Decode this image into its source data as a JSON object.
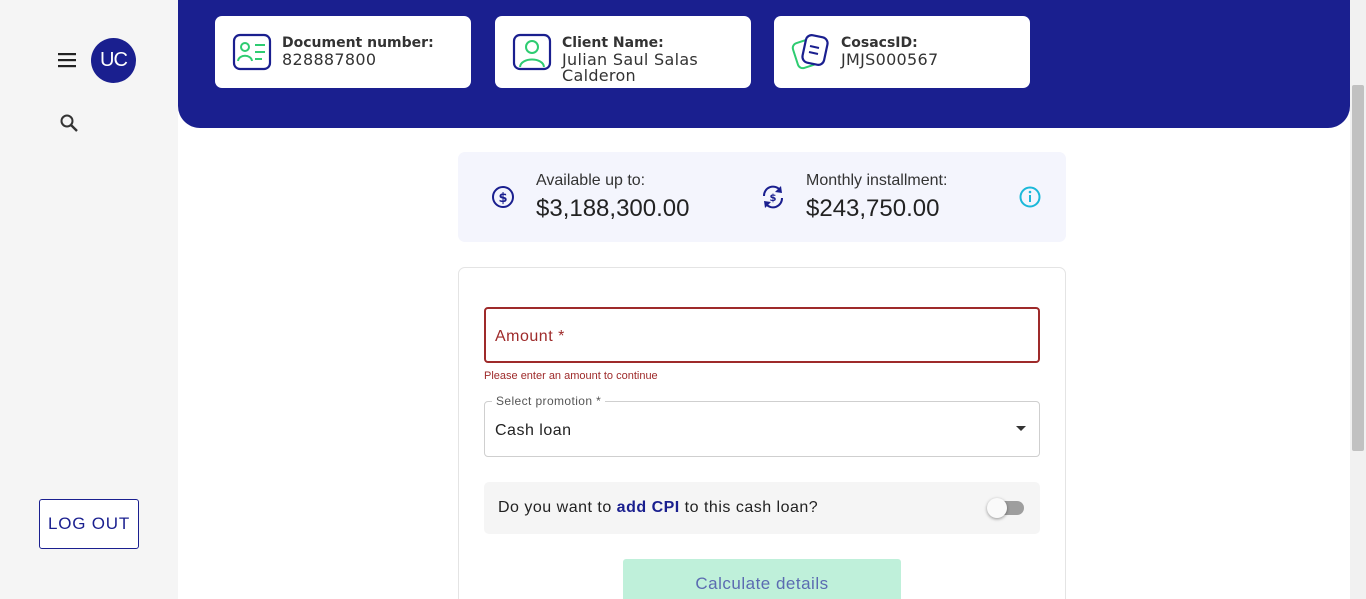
{
  "sidebar": {
    "menu_icon": "menu-icon",
    "avatar_initials": "UC",
    "search_icon": "search-icon",
    "logout_label": "LOG OUT"
  },
  "header": {
    "cards": [
      {
        "icon": "id-card-icon",
        "label": "Document number:",
        "value": "828887800"
      },
      {
        "icon": "user-icon",
        "label": "Client Name:",
        "value": "Julian Saul Salas Calderon"
      },
      {
        "icon": "document-icon",
        "label": "CosacsID:",
        "value": "JMJS000567"
      }
    ]
  },
  "summary": {
    "available_label": "Available up to:",
    "available_value": "$3,188,300.00",
    "installment_label": "Monthly installment:",
    "installment_value": "$243,750.00",
    "info_icon": "info-icon"
  },
  "form": {
    "amount_label": "Amount *",
    "amount_value": "",
    "amount_error": "Please enter an amount to continue",
    "promotion_label": "Select promotion *",
    "promotion_value": "Cash loan",
    "cpi_question_before": "Do you want to ",
    "cpi_question_highlight": "add CPI",
    "cpi_question_after": " to this cash loan?",
    "cpi_enabled": false,
    "calculate_label": "Calculate details"
  },
  "colors": {
    "primary": "#1a1f8f",
    "error": "#9e2a2a",
    "accent_green": "#2ecc71",
    "info_cyan": "#1bb8d9",
    "button_disabled_bg": "#bff0da"
  }
}
